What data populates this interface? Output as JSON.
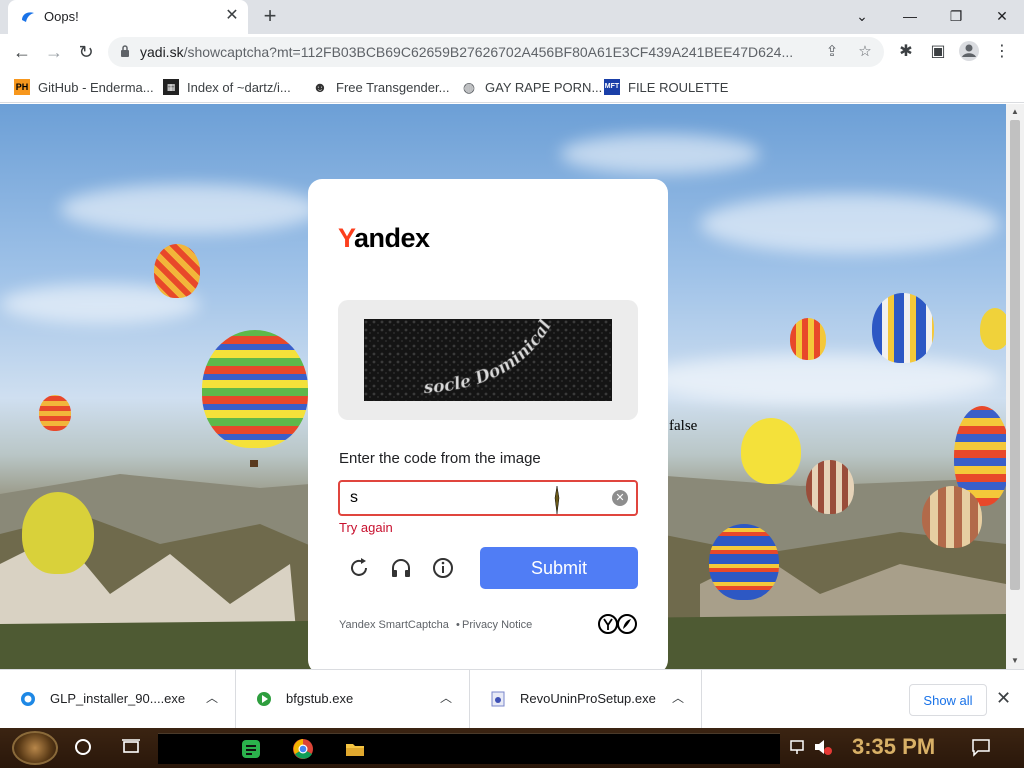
{
  "browser": {
    "tab": {
      "title": "Oops!"
    },
    "url": {
      "host": "yadi.sk",
      "path": "/showcaptcha?mt=112FB03BCB69C62659B27626702A456BF80A61E3CF439A241BEE47D624..."
    },
    "bookmarks": [
      {
        "label": "GitHub - Enderma...",
        "icon": "PH"
      },
      {
        "label": "Index of ~dartz/i...",
        "icon": "grid-icon"
      },
      {
        "label": "Free Transgender...",
        "icon": "anon-mask-icon"
      },
      {
        "label": "GAY RAPE PORN...",
        "icon": "globe-icon"
      },
      {
        "label": "FILE ROULETTE",
        "icon": "MFT"
      }
    ]
  },
  "page": {
    "stray_text": "false",
    "captcha": {
      "brand": {
        "first": "Y",
        "rest": "andex"
      },
      "prompt": "Enter the code from the image",
      "image_text": "socle Dominical",
      "input_value": "s",
      "error": "Try again",
      "submit_label": "Submit",
      "footer": {
        "smartcaptcha": "Yandex SmartCaptcha",
        "separator": "•",
        "privacy": "Privacy Notice"
      }
    }
  },
  "downloads": {
    "items": [
      {
        "name": "GLP_installer_90....exe"
      },
      {
        "name": "bfgstub.exe"
      },
      {
        "name": "RevoUninProSetup.exe"
      }
    ],
    "show_all": "Show all"
  },
  "taskbar": {
    "clock": "3:35 PM"
  },
  "colors": {
    "yandex_red": "#fc3f1d",
    "error_red": "#e0453e",
    "submit_blue": "#507df5"
  }
}
